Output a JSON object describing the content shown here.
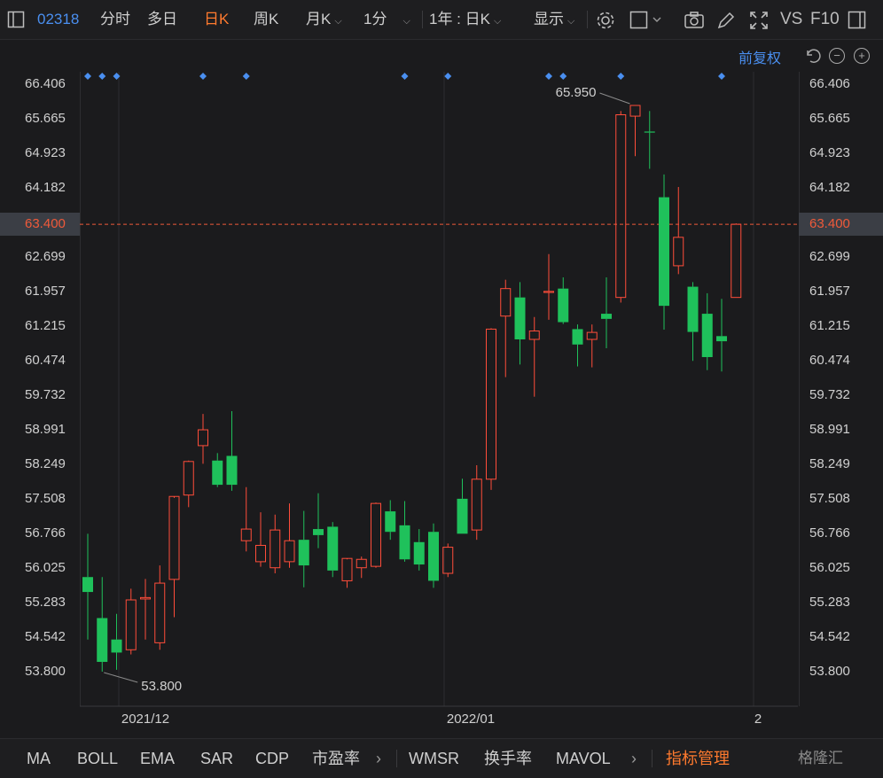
{
  "toolbar": {
    "code": "02318",
    "tabs": [
      "分时",
      "多日",
      "日K",
      "周K",
      "月K",
      "1分"
    ],
    "active_tab": "日K",
    "range_select": "1年 : 日K",
    "display_label": "显示",
    "vs_label": "VS",
    "f10_label": "F10"
  },
  "adjust_label": "前复权",
  "current_price_label": "63.400",
  "colors": {
    "up": "#ff4d3a",
    "down": "#1fc15b",
    "accent": "#ff7a2e",
    "link": "#4a8ff0"
  },
  "indicators": [
    "MA",
    "BOLL",
    "EMA",
    "SAR",
    "CDP",
    "市盈率",
    "WMSR",
    "换手率",
    "MAVOL"
  ],
  "indicator_manage": "指标管理",
  "watermark": "格隆汇",
  "chart_data": {
    "type": "candlestick",
    "y_ticks": [
      "66.406",
      "65.665",
      "64.923",
      "64.182",
      "63.400",
      "62.699",
      "61.957",
      "61.215",
      "60.474",
      "59.732",
      "58.991",
      "58.249",
      "57.508",
      "56.766",
      "56.025",
      "55.283",
      "54.542",
      "53.800"
    ],
    "ylim": [
      53.8,
      66.406
    ],
    "x_ticks": [
      {
        "label": "2021/12",
        "index": 2
      },
      {
        "label": "2022/01",
        "index": 24
      },
      {
        "label": "2",
        "index": 45
      }
    ],
    "high_label": "65.950",
    "low_label": "53.800",
    "current_price": 63.4,
    "event_markers": [
      0,
      1,
      2,
      8,
      11,
      22,
      25,
      32,
      33,
      37,
      44
    ],
    "candles": [
      {
        "o": 55.83,
        "h": 56.76,
        "l": 54.49,
        "c": 55.51
      },
      {
        "o": 54.95,
        "h": 55.83,
        "l": 53.8,
        "c": 54.01
      },
      {
        "o": 54.49,
        "h": 55.04,
        "l": 53.84,
        "c": 54.21
      },
      {
        "o": 54.27,
        "h": 55.58,
        "l": 54.17,
        "c": 55.34
      },
      {
        "o": 55.36,
        "h": 55.79,
        "l": 54.49,
        "c": 55.39
      },
      {
        "o": 54.42,
        "h": 56.08,
        "l": 54.27,
        "c": 55.7
      },
      {
        "o": 55.78,
        "h": 57.53,
        "l": 54.97,
        "c": 57.56
      },
      {
        "o": 57.59,
        "h": 58.33,
        "l": 57.33,
        "c": 58.31
      },
      {
        "o": 58.65,
        "h": 59.33,
        "l": 58.26,
        "c": 58.99
      },
      {
        "o": 58.33,
        "h": 58.49,
        "l": 57.76,
        "c": 57.81
      },
      {
        "o": 58.43,
        "h": 59.39,
        "l": 57.68,
        "c": 57.81
      },
      {
        "o": 56.61,
        "h": 57.76,
        "l": 56.38,
        "c": 56.86
      },
      {
        "o": 56.16,
        "h": 57.22,
        "l": 56.05,
        "c": 56.51
      },
      {
        "o": 56.03,
        "h": 57.17,
        "l": 55.91,
        "c": 56.84
      },
      {
        "o": 56.16,
        "h": 57.41,
        "l": 56.03,
        "c": 56.61
      },
      {
        "o": 56.63,
        "h": 57.25,
        "l": 55.61,
        "c": 56.08
      },
      {
        "o": 56.86,
        "h": 57.63,
        "l": 56.45,
        "c": 56.73
      },
      {
        "o": 56.91,
        "h": 57.01,
        "l": 55.83,
        "c": 55.97
      },
      {
        "o": 55.75,
        "h": 56.21,
        "l": 55.6,
        "c": 56.23
      },
      {
        "o": 56.03,
        "h": 56.27,
        "l": 55.81,
        "c": 56.21
      },
      {
        "o": 56.06,
        "h": 57.43,
        "l": 56.03,
        "c": 57.41
      },
      {
        "o": 57.24,
        "h": 57.48,
        "l": 56.63,
        "c": 56.8
      },
      {
        "o": 56.94,
        "h": 57.46,
        "l": 56.16,
        "c": 56.21
      },
      {
        "o": 56.58,
        "h": 56.86,
        "l": 55.97,
        "c": 56.1
      },
      {
        "o": 56.8,
        "h": 56.98,
        "l": 55.6,
        "c": 55.75
      },
      {
        "o": 55.91,
        "h": 56.55,
        "l": 55.83,
        "c": 56.47
      },
      {
        "o": 57.51,
        "h": 57.94,
        "l": 56.76,
        "c": 56.76
      },
      {
        "o": 56.84,
        "h": 58.23,
        "l": 56.63,
        "c": 57.93
      },
      {
        "o": 57.93,
        "h": 61.17,
        "l": 57.7,
        "c": 61.15
      },
      {
        "o": 61.43,
        "h": 62.21,
        "l": 60.12,
        "c": 62.02
      },
      {
        "o": 61.83,
        "h": 62.16,
        "l": 60.39,
        "c": 60.93
      },
      {
        "o": 60.93,
        "h": 61.41,
        "l": 59.7,
        "c": 61.11
      },
      {
        "o": 61.96,
        "h": 62.76,
        "l": 61.35,
        "c": 61.96
      },
      {
        "o": 62.02,
        "h": 62.26,
        "l": 61.26,
        "c": 61.3
      },
      {
        "o": 61.15,
        "h": 61.25,
        "l": 60.35,
        "c": 60.82
      },
      {
        "o": 60.93,
        "h": 61.25,
        "l": 60.33,
        "c": 61.08
      },
      {
        "o": 61.48,
        "h": 62.26,
        "l": 60.74,
        "c": 61.37
      },
      {
        "o": 61.83,
        "h": 65.83,
        "l": 61.72,
        "c": 65.75
      },
      {
        "o": 65.72,
        "h": 65.95,
        "l": 64.86,
        "c": 65.95
      },
      {
        "o": 65.39,
        "h": 65.83,
        "l": 64.59,
        "c": 65.37
      },
      {
        "o": 63.98,
        "h": 64.47,
        "l": 61.14,
        "c": 61.65
      },
      {
        "o": 62.51,
        "h": 64.2,
        "l": 62.33,
        "c": 63.12
      },
      {
        "o": 62.06,
        "h": 62.16,
        "l": 60.47,
        "c": 61.09
      },
      {
        "o": 61.48,
        "h": 61.92,
        "l": 60.27,
        "c": 60.55
      },
      {
        "o": 61.0,
        "h": 61.8,
        "l": 60.24,
        "c": 60.89
      },
      {
        "o": 61.83,
        "h": 63.42,
        "l": 61.83,
        "c": 63.4
      }
    ]
  }
}
